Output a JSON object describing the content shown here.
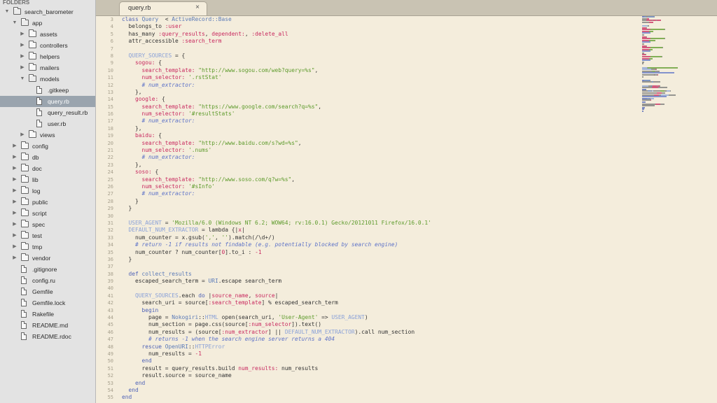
{
  "sidebar": {
    "title": "FOLDERS",
    "tree": [
      {
        "label": "search_barometer",
        "type": "folder",
        "open": true,
        "depth": 0
      },
      {
        "label": "app",
        "type": "folder",
        "open": true,
        "depth": 1
      },
      {
        "label": "assets",
        "type": "folder",
        "open": false,
        "depth": 2
      },
      {
        "label": "controllers",
        "type": "folder",
        "open": false,
        "depth": 2
      },
      {
        "label": "helpers",
        "type": "folder",
        "open": false,
        "depth": 2
      },
      {
        "label": "mailers",
        "type": "folder",
        "open": false,
        "depth": 2
      },
      {
        "label": "models",
        "type": "folder",
        "open": true,
        "depth": 2
      },
      {
        "label": ".gitkeep",
        "type": "file",
        "depth": 3
      },
      {
        "label": "query.rb",
        "type": "file",
        "depth": 3,
        "selected": true
      },
      {
        "label": "query_result.rb",
        "type": "file",
        "depth": 3
      },
      {
        "label": "user.rb",
        "type": "file",
        "depth": 3
      },
      {
        "label": "views",
        "type": "folder",
        "open": false,
        "depth": 2
      },
      {
        "label": "config",
        "type": "folder",
        "open": false,
        "depth": 1
      },
      {
        "label": "db",
        "type": "folder",
        "open": false,
        "depth": 1
      },
      {
        "label": "doc",
        "type": "folder",
        "open": false,
        "depth": 1
      },
      {
        "label": "lib",
        "type": "folder",
        "open": false,
        "depth": 1
      },
      {
        "label": "log",
        "type": "folder",
        "open": false,
        "depth": 1
      },
      {
        "label": "public",
        "type": "folder",
        "open": false,
        "depth": 1
      },
      {
        "label": "script",
        "type": "folder",
        "open": false,
        "depth": 1
      },
      {
        "label": "spec",
        "type": "folder",
        "open": false,
        "depth": 1
      },
      {
        "label": "test",
        "type": "folder",
        "open": false,
        "depth": 1
      },
      {
        "label": "tmp",
        "type": "folder",
        "open": false,
        "depth": 1
      },
      {
        "label": "vendor",
        "type": "folder",
        "open": false,
        "depth": 1
      },
      {
        "label": ".gitignore",
        "type": "file",
        "depth": 1
      },
      {
        "label": "config.ru",
        "type": "file",
        "depth": 1
      },
      {
        "label": "Gemfile",
        "type": "file",
        "depth": 1
      },
      {
        "label": "Gemfile.lock",
        "type": "file",
        "depth": 1
      },
      {
        "label": "Rakefile",
        "type": "file",
        "depth": 1
      },
      {
        "label": "README.md",
        "type": "file",
        "depth": 1
      },
      {
        "label": "README.rdoc",
        "type": "file",
        "depth": 1
      }
    ]
  },
  "tabs": [
    {
      "label": "query.rb",
      "close": "×",
      "active": true
    }
  ],
  "editor": {
    "first_line_number": 3,
    "lines": [
      [
        [
          "kw",
          "class "
        ],
        [
          "cls",
          "Query"
        ],
        [
          "",
          "  < "
        ],
        [
          "cls",
          "ActiveRecord::Base"
        ]
      ],
      [
        [
          "",
          "  belongs_to "
        ],
        [
          "sym",
          ":user"
        ]
      ],
      [
        [
          "",
          "  has_many "
        ],
        [
          "sym",
          ":query_results"
        ],
        [
          "",
          ", "
        ],
        [
          "sym",
          "dependent:"
        ],
        [
          "",
          ", "
        ],
        [
          "sym",
          ":delete_all"
        ]
      ],
      [
        [
          "",
          "  attr_accessible "
        ],
        [
          "sym",
          ":search_term"
        ]
      ],
      [],
      [
        [
          "con",
          "  QUERY_SOURCES"
        ],
        [
          "",
          " = {"
        ]
      ],
      [
        [
          "sym",
          "    sogou:"
        ],
        [
          "",
          " {"
        ]
      ],
      [
        [
          "sym",
          "      search_template:"
        ],
        [
          "str",
          " \"http://www.sogou.com/web?query=%s\""
        ],
        [
          "",
          ","
        ]
      ],
      [
        [
          "sym",
          "      num_selector:"
        ],
        [
          "str",
          " '.rstStat'"
        ]
      ],
      [
        [
          "cm",
          "      # num_extractor:"
        ]
      ],
      [
        [
          "",
          "    },"
        ]
      ],
      [
        [
          "sym",
          "    google:"
        ],
        [
          "",
          " {"
        ]
      ],
      [
        [
          "sym",
          "      search_template:"
        ],
        [
          "str",
          " \"https://www.google.com/search?q=%s\""
        ],
        [
          "",
          ","
        ]
      ],
      [
        [
          "sym",
          "      num_selector:"
        ],
        [
          "str",
          " '#resultStats'"
        ]
      ],
      [
        [
          "cm",
          "      # num_extractor:"
        ]
      ],
      [
        [
          "",
          "    },"
        ]
      ],
      [
        [
          "sym",
          "    baidu:"
        ],
        [
          "",
          " {"
        ]
      ],
      [
        [
          "sym",
          "      search_template:"
        ],
        [
          "str",
          " \"http://www.baidu.com/s?wd=%s\""
        ],
        [
          "",
          ","
        ]
      ],
      [
        [
          "sym",
          "      num_selector:"
        ],
        [
          "str",
          " '.nums'"
        ]
      ],
      [
        [
          "cm",
          "      # num_extractor:"
        ]
      ],
      [
        [
          "",
          "    },"
        ]
      ],
      [
        [
          "sym",
          "    soso:"
        ],
        [
          "",
          " {"
        ]
      ],
      [
        [
          "sym",
          "      search_template:"
        ],
        [
          "str",
          " \"http://www.soso.com/q?w=%s\""
        ],
        [
          "",
          ","
        ]
      ],
      [
        [
          "sym",
          "      num_selector:"
        ],
        [
          "str",
          " '#sInfo'"
        ]
      ],
      [
        [
          "cm",
          "      # num_extractor:"
        ]
      ],
      [
        [
          "",
          "    }"
        ]
      ],
      [
        [
          "",
          "  }"
        ]
      ],
      [],
      [
        [
          "con",
          "  USER_AGENT"
        ],
        [
          "",
          " = "
        ],
        [
          "str",
          "'Mozilla/6.0 (Windows NT 6.2; WOW64; rv:16.0.1) Gecko/20121011 Firefox/16.0.1'"
        ]
      ],
      [
        [
          "con",
          "  DEFAULT_NUM_EXTRACTOR"
        ],
        [
          "",
          " = lambda {|"
        ],
        [
          "sym",
          "x"
        ],
        [
          "",
          "|"
        ]
      ],
      [
        [
          "",
          "    num_counter = x.gsub("
        ],
        [
          "str",
          "','"
        ],
        [
          "",
          ", "
        ],
        [
          "str",
          "''"
        ],
        [
          "",
          ").match(/\\d+/)"
        ]
      ],
      [
        [
          "cm",
          "    # return -1 if results not findable (e.g. potentially blocked by search engine)"
        ]
      ],
      [
        [
          "",
          "    num_counter ? num_counter["
        ],
        [
          "sym",
          "0"
        ],
        [
          "",
          "].to_i : "
        ],
        [
          "sym",
          "-1"
        ]
      ],
      [
        [
          "",
          "  }"
        ]
      ],
      [],
      [
        [
          "kw",
          "  def "
        ],
        [
          "cls",
          "collect_results"
        ]
      ],
      [
        [
          "",
          "    escaped_search_term = "
        ],
        [
          "cls",
          "URI"
        ],
        [
          "",
          ".escape search_term"
        ]
      ],
      [],
      [
        [
          "con",
          "    QUERY_SOURCES"
        ],
        [
          "",
          ".each "
        ],
        [
          "kw",
          "do"
        ],
        [
          "",
          " |"
        ],
        [
          "sym",
          "source_name"
        ],
        [
          "",
          ", "
        ],
        [
          "sym",
          "source"
        ],
        [
          "",
          "|"
        ]
      ],
      [
        [
          "",
          "      search_uri = source["
        ],
        [
          "sym",
          ":search_template"
        ],
        [
          "",
          "] % escaped_search_term"
        ]
      ],
      [
        [
          "kw",
          "      begin"
        ]
      ],
      [
        [
          "",
          "        page = "
        ],
        [
          "cls",
          "Nokogiri"
        ],
        [
          "",
          "::"
        ],
        [
          "con",
          "HTML"
        ],
        [
          "",
          " open(search_uri, "
        ],
        [
          "str",
          "'User-Agent'"
        ],
        [
          "",
          " => "
        ],
        [
          "con",
          "USER_AGENT"
        ],
        [
          "",
          ")"
        ]
      ],
      [
        [
          "",
          "        num_section = page.css(source["
        ],
        [
          "sym",
          ":num_selector"
        ],
        [
          "",
          "]).text()"
        ]
      ],
      [
        [
          "",
          "        num_results = (source["
        ],
        [
          "sym",
          ":num_extractor"
        ],
        [
          "",
          "] || "
        ],
        [
          "con",
          "DEFAULT_NUM_EXTRACTOR"
        ],
        [
          "",
          ").call num_section"
        ]
      ],
      [
        [
          "cm",
          "        # returns -1 when the search engine server returns a 404"
        ]
      ],
      [
        [
          "kw",
          "      rescue "
        ],
        [
          "cls",
          "OpenURI"
        ],
        [
          "",
          "::"
        ],
        [
          "con",
          "HTTPError"
        ]
      ],
      [
        [
          "",
          "        num_results = "
        ],
        [
          "sym",
          "-1"
        ]
      ],
      [
        [
          "kw",
          "      end"
        ]
      ],
      [
        [
          "",
          "      result = query_results.build "
        ],
        [
          "sym",
          "num_results:"
        ],
        [
          "",
          " num_results"
        ]
      ],
      [
        [
          "",
          "      result.source = source_name"
        ]
      ],
      [
        [
          "kw",
          "    end"
        ]
      ],
      [
        [
          "kw",
          "  end"
        ]
      ],
      [
        [
          "kw",
          "end"
        ]
      ]
    ]
  },
  "colors": {
    "editor_bg": "#f4eddc",
    "sidebar_bg": "#e3e3e3",
    "selection": "#9aa4ae",
    "keyword": "#4f63b7",
    "symbol": "#c8285e",
    "string": "#5c9a2a",
    "comment": "#5e73c8"
  }
}
